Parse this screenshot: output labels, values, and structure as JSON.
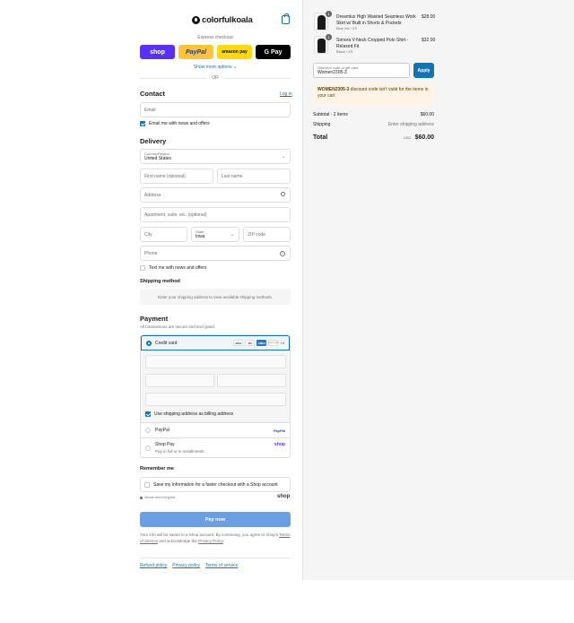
{
  "brand": {
    "name": "colorfulkoala"
  },
  "express": {
    "label": "Express checkout",
    "buttons": [
      "shop",
      "PayPal",
      "amazon pay",
      "G Pay"
    ],
    "more": "Show more options ⌄",
    "or": "OR"
  },
  "contact": {
    "title": "Contact",
    "login": "Log in",
    "email_placeholder": "Email",
    "email_news": "Email me with news and offers"
  },
  "delivery": {
    "title": "Delivery",
    "country_label": "Country/Region",
    "country_value": "United States",
    "first_name": "First name (optional)",
    "last_name": "Last name",
    "address": "Address",
    "apartment": "Apartment, suite, etc. (optional)",
    "city": "City",
    "state_label": "State",
    "state_value": "Iowa",
    "zip": "ZIP code",
    "phone": "Phone",
    "text_news": "Text me with news and offers"
  },
  "shipping": {
    "title": "Shipping method",
    "placeholder": "Enter your shipping address to view available shipping methods."
  },
  "payment": {
    "title": "Payment",
    "subtitle": "All transactions are secure and encrypted.",
    "credit_card": "Credit card",
    "card_brands": [
      "VISA",
      "MC",
      "AMEX",
      "DISCOVER",
      "+4"
    ],
    "billing_same": "Use shipping address as billing address",
    "paypal": "PayPal",
    "paypal_logo": "PayPal",
    "shop_pay": "Shop Pay",
    "shop_pay_sub": "Pay in full or in installments",
    "shop_logo": "shop"
  },
  "remember": {
    "title": "Remember me",
    "save_info": "Save my information for a faster checkout with a Shop account",
    "secure": "Secure and encrypted",
    "shop_logo": "shop"
  },
  "paynow": "Pay now",
  "legal": {
    "text1": "Your info will be saved to a Shop account. By continuing, you agree to Shop's",
    "terms": "Terms of Service",
    "text2": "and acknowledge the",
    "privacy": "Privacy Policy",
    "dot": "."
  },
  "footer_links": [
    "Refund policy",
    "Privacy policy",
    "Terms of service"
  ],
  "cart": {
    "items": [
      {
        "qty": "1",
        "name": "Dreamlux High Waisted Seamless Work Skirt w/ Built in Shorts & Pockets",
        "variant": "Blue Ink / XS",
        "price": "$28.00"
      },
      {
        "qty": "1",
        "name": "Sonora V-Neck Cropped Polo Shirt - Relaxed Fit",
        "variant": "Black / XS",
        "price": "$32.00"
      }
    ],
    "discount_label": "Discount code or gift card",
    "discount_value": "Women2305-3",
    "apply": "Apply",
    "warning_code": "WOMEN2305-3",
    "warning_text": " discount code isn't valid for the items in your cart",
    "subtotal_label": "Subtotal · 2 items",
    "subtotal_value": "$60.00",
    "shipping_label": "Shipping",
    "shipping_value": "Enter shipping address",
    "total_label": "Total",
    "currency": "USD",
    "total_value": "$60.00"
  }
}
